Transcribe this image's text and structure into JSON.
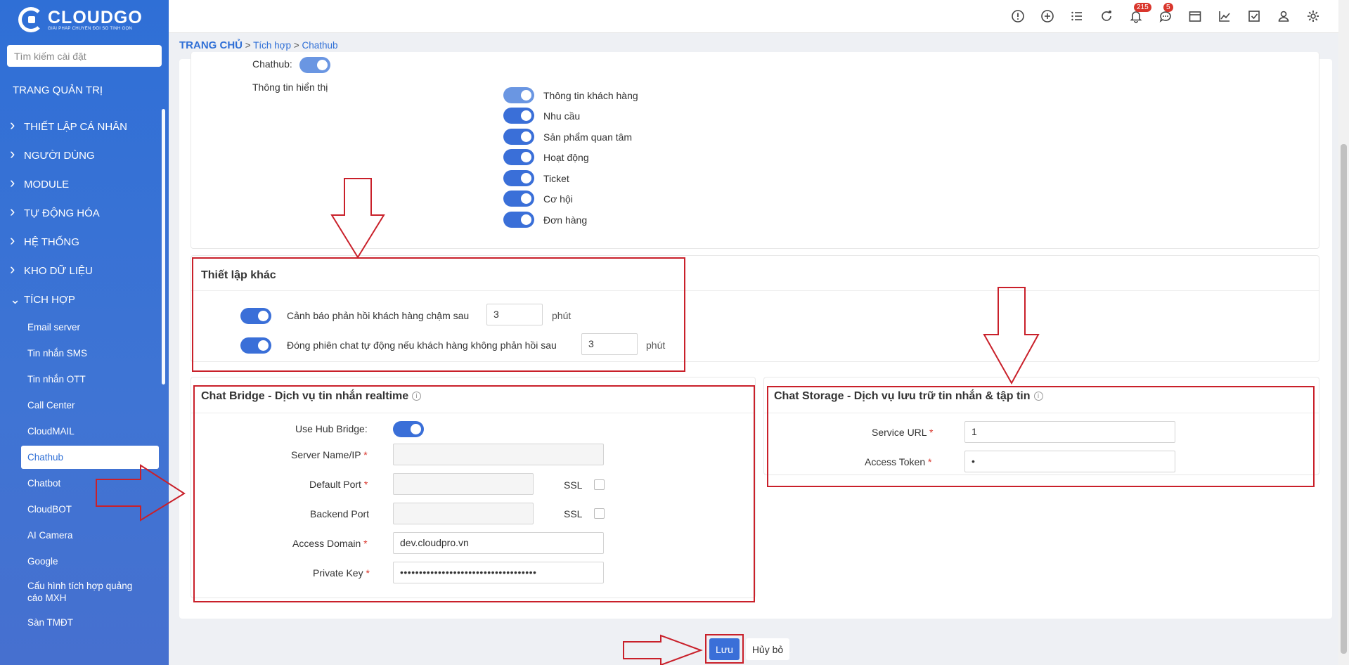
{
  "sidebar": {
    "logo_name": "CLOUDGO",
    "logo_tagline": "GIẢI PHÁP CHUYỂN ĐỔI SỐ TINH GỌN",
    "search_placeholder": "Tìm kiếm cài đặt",
    "admin_title": "TRANG QUẢN TRỊ",
    "groups": [
      {
        "label": "THIẾT LẬP CÁ NHÂN"
      },
      {
        "label": "NGƯỜI DÙNG"
      },
      {
        "label": "MODULE"
      },
      {
        "label": "TỰ ĐỘNG HÓA"
      },
      {
        "label": "HỆ THỐNG"
      },
      {
        "label": "KHO DỮ LIỆU"
      },
      {
        "label": "TÍCH HỢP"
      }
    ],
    "sub_items": [
      {
        "label": "Email server"
      },
      {
        "label": "Tin nhắn SMS"
      },
      {
        "label": "Tin nhắn OTT"
      },
      {
        "label": "Call Center"
      },
      {
        "label": "CloudMAIL"
      },
      {
        "label": "Chathub"
      },
      {
        "label": "Chatbot"
      },
      {
        "label": "CloudBOT"
      },
      {
        "label": "AI Camera"
      },
      {
        "label": "Google"
      },
      {
        "label": "Cấu hình tích hợp quảng cáo MXH"
      },
      {
        "label": "Sàn TMĐT"
      }
    ]
  },
  "header": {
    "notifications_count": "215",
    "messages_count": "5"
  },
  "breadcrumb": {
    "home": "TRANG CHỦ",
    "sep": ">",
    "level1": "Tích hợp",
    "level2": "Chathub"
  },
  "display_section": {
    "chathub_label": "Chathub:",
    "display_info_label": "Thông tin hiển thị",
    "toggles": [
      {
        "label": "Thông tin khách hàng"
      },
      {
        "label": "Nhu cầu"
      },
      {
        "label": "Sản phẩm quan tâm"
      },
      {
        "label": "Hoạt động"
      },
      {
        "label": "Ticket"
      },
      {
        "label": "Cơ hội"
      },
      {
        "label": "Đơn hàng"
      }
    ]
  },
  "other_settings": {
    "title": "Thiết lập khác",
    "slow_reply_label": "Cảnh báo phản hồi khách hàng chậm sau",
    "slow_reply_value": "3",
    "auto_close_label": "Đóng phiên chat tự động nếu khách hàng không phản hồi sau",
    "auto_close_value": "3",
    "unit": "phút"
  },
  "chat_bridge": {
    "title": "Chat Bridge - Dịch vụ tin nhắn realtime",
    "use_hub_bridge_label": "Use Hub Bridge:",
    "server_name_label": "Server Name/IP",
    "server_name_value": "",
    "default_port_label": "Default Port",
    "default_port_value": "",
    "backend_port_label": "Backend Port",
    "backend_port_value": "",
    "ssl_label": "SSL",
    "access_domain_label": "Access Domain",
    "access_domain_value": "dev.cloudpro.vn",
    "private_key_label": "Private Key",
    "private_key_value": "••••••••••••••••••••••••••••••••••••",
    "required_mark": "*"
  },
  "chat_storage": {
    "title": "Chat Storage - Dịch vụ lưu trữ tin nhắn & tập tin",
    "service_url_label": "Service URL",
    "service_url_value": "1",
    "access_token_label": "Access Token",
    "access_token_value": "•"
  },
  "footer": {
    "save_label": "Lưu",
    "cancel_label": "Hủy bỏ"
  },
  "annotations": {
    "color": "#c9202a"
  },
  "info_icon_glyph": "i"
}
